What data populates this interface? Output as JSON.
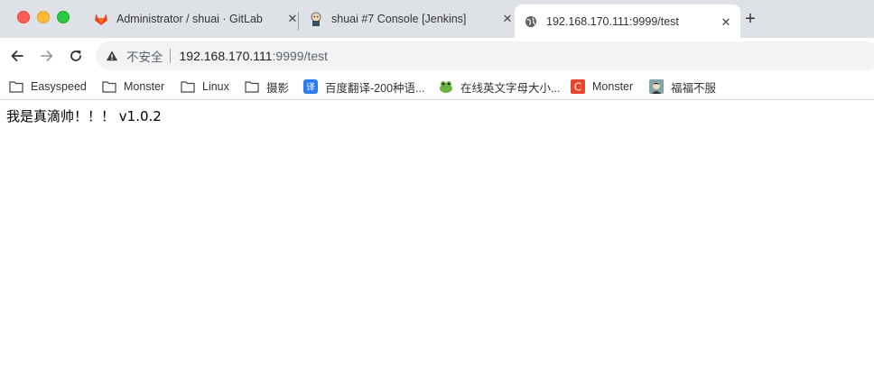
{
  "tabs": [
    {
      "title": "Administrator / shuai · GitLab",
      "icon": "gitlab-icon"
    },
    {
      "title": "shuai #7 Console [Jenkins]",
      "icon": "jenkins-icon"
    },
    {
      "title": "192.168.170.111:9999/test",
      "icon": "globe-icon"
    }
  ],
  "address": {
    "security_label": "不安全",
    "host": "192.168.170.111",
    "path": ":9999/test"
  },
  "bookmarks": [
    {
      "label": "Easyspeed",
      "icon": "folder-icon"
    },
    {
      "label": "Monster",
      "icon": "folder-icon"
    },
    {
      "label": "Linux",
      "icon": "folder-icon"
    },
    {
      "label": "摄影",
      "icon": "folder-icon"
    },
    {
      "label": "百度翻译-200种语...",
      "icon": "translate-icon"
    },
    {
      "label": "在线英文字母大小...",
      "icon": "frog-icon"
    },
    {
      "label": "Monster",
      "icon": "c-logo-icon"
    },
    {
      "label": "福福不服",
      "icon": "avatar-icon"
    }
  ],
  "page": {
    "text": "我是真滴帅！！！ v1.0.2"
  },
  "colors": {
    "tabstrip_bg": "#dee1e6",
    "gitlab": "#e24329",
    "baidu_translate": "#2b7cf0",
    "monster_c": "#e8462e"
  }
}
